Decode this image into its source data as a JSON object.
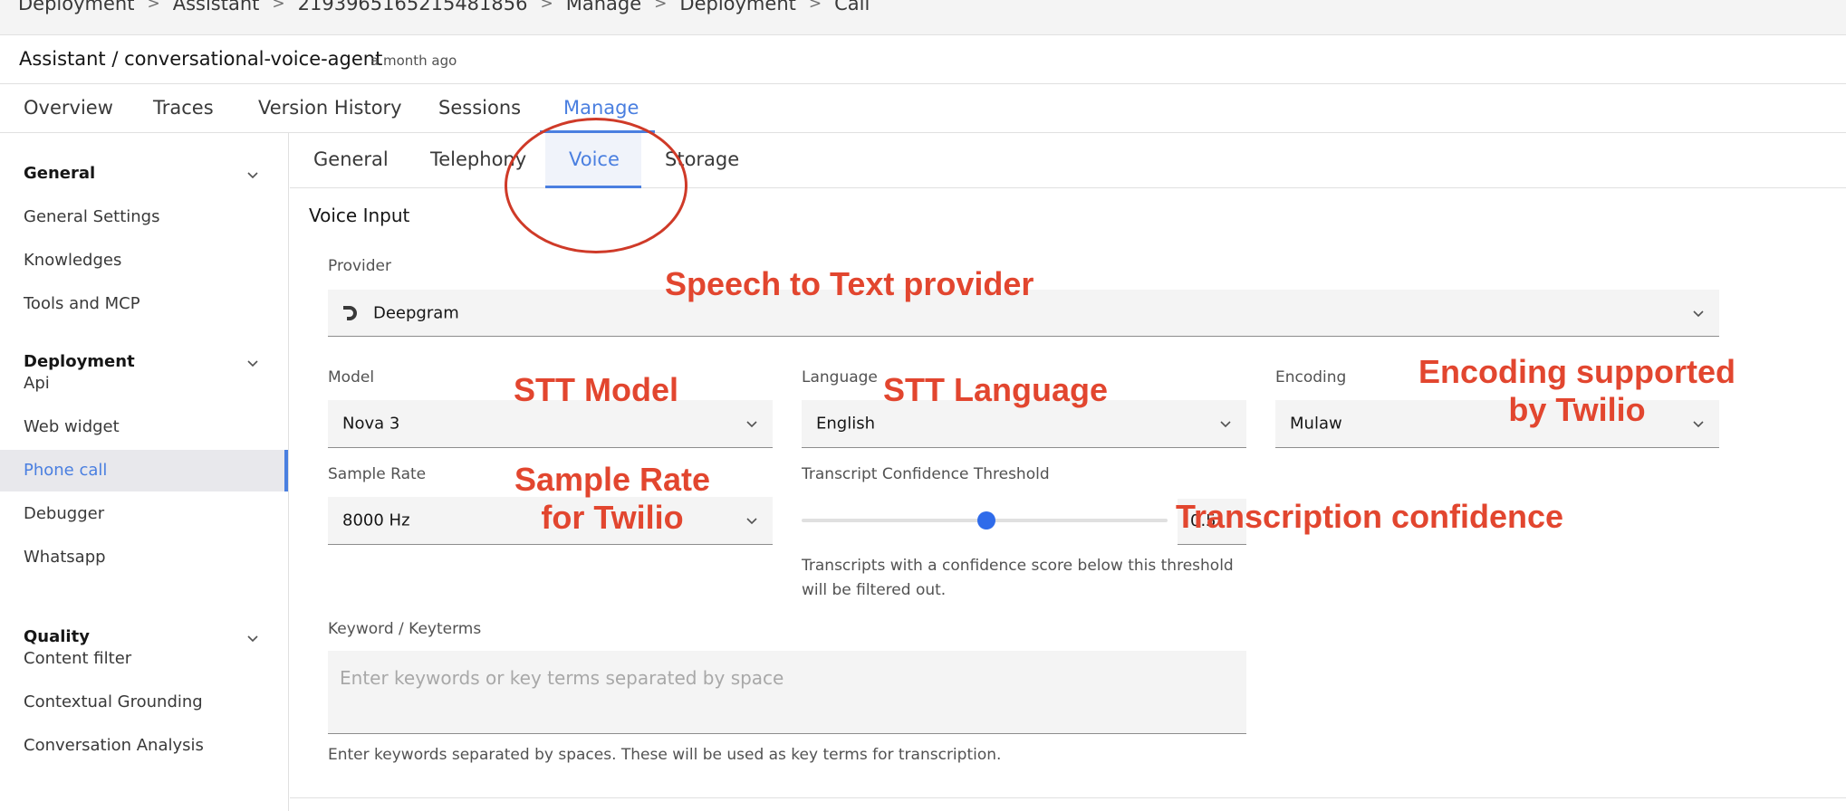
{
  "breadcrumb": [
    "Deployment",
    "Assistant",
    "2193965165215481856",
    "Manage",
    "Deployment",
    "Call"
  ],
  "header": {
    "title": "Assistant / conversational-voice-agent",
    "updated": "a month ago"
  },
  "main_tabs": [
    "Overview",
    "Traces",
    "Version History",
    "Sessions",
    "Manage"
  ],
  "active_main_tab": "Manage",
  "sidebar": {
    "groups": [
      {
        "label": "General",
        "items": [
          "General Settings",
          "Knowledges",
          "Tools and MCP"
        ]
      },
      {
        "label": "Deployment",
        "items": [
          "Api",
          "Web widget",
          "Phone call",
          "Debugger",
          "Whatsapp"
        ]
      },
      {
        "label": "Quality",
        "items": [
          "Content filter",
          "Contextual Grounding",
          "Conversation Analysis"
        ]
      }
    ],
    "active_item": "Phone call"
  },
  "sub_tabs": [
    "General",
    "Telephony",
    "Voice",
    "Storage"
  ],
  "active_sub_tab": "Voice",
  "voice_input": {
    "section_title": "Voice Input",
    "provider": {
      "label": "Provider",
      "value": "Deepgram"
    },
    "model": {
      "label": "Model",
      "value": "Nova 3"
    },
    "language": {
      "label": "Language",
      "value": "English"
    },
    "encoding": {
      "label": "Encoding",
      "value": "Mulaw"
    },
    "sample_rate": {
      "label": "Sample Rate",
      "value": "8000 Hz"
    },
    "threshold": {
      "label": "Transcript Confidence Threshold",
      "value": "0.5",
      "level": 0.5,
      "helper": "Transcripts with a confidence score below this threshold will be filtered out."
    },
    "keywords": {
      "label": "Keyword / Keyterms",
      "placeholder": "Enter keywords or key terms separated by space",
      "helper": "Enter keywords separated by spaces. These will be used as key terms for transcription."
    }
  },
  "annotations": {
    "provider": "Speech to Text provider",
    "model": "STT Model",
    "language": "STT Language",
    "encoding_line1": "Encoding supported",
    "encoding_line2": "by Twilio",
    "sample_rate_line1": "Sample Rate",
    "sample_rate_line2": "for Twilio",
    "confidence": "Transcription confidence"
  },
  "colors": {
    "accent": "#4a7fe0",
    "annotation": "#e2462f",
    "slider_thumb": "#2f6bea"
  },
  "icons": [
    "chevron-right-icon",
    "chevron-down-icon",
    "deepgram-logo-icon"
  ]
}
